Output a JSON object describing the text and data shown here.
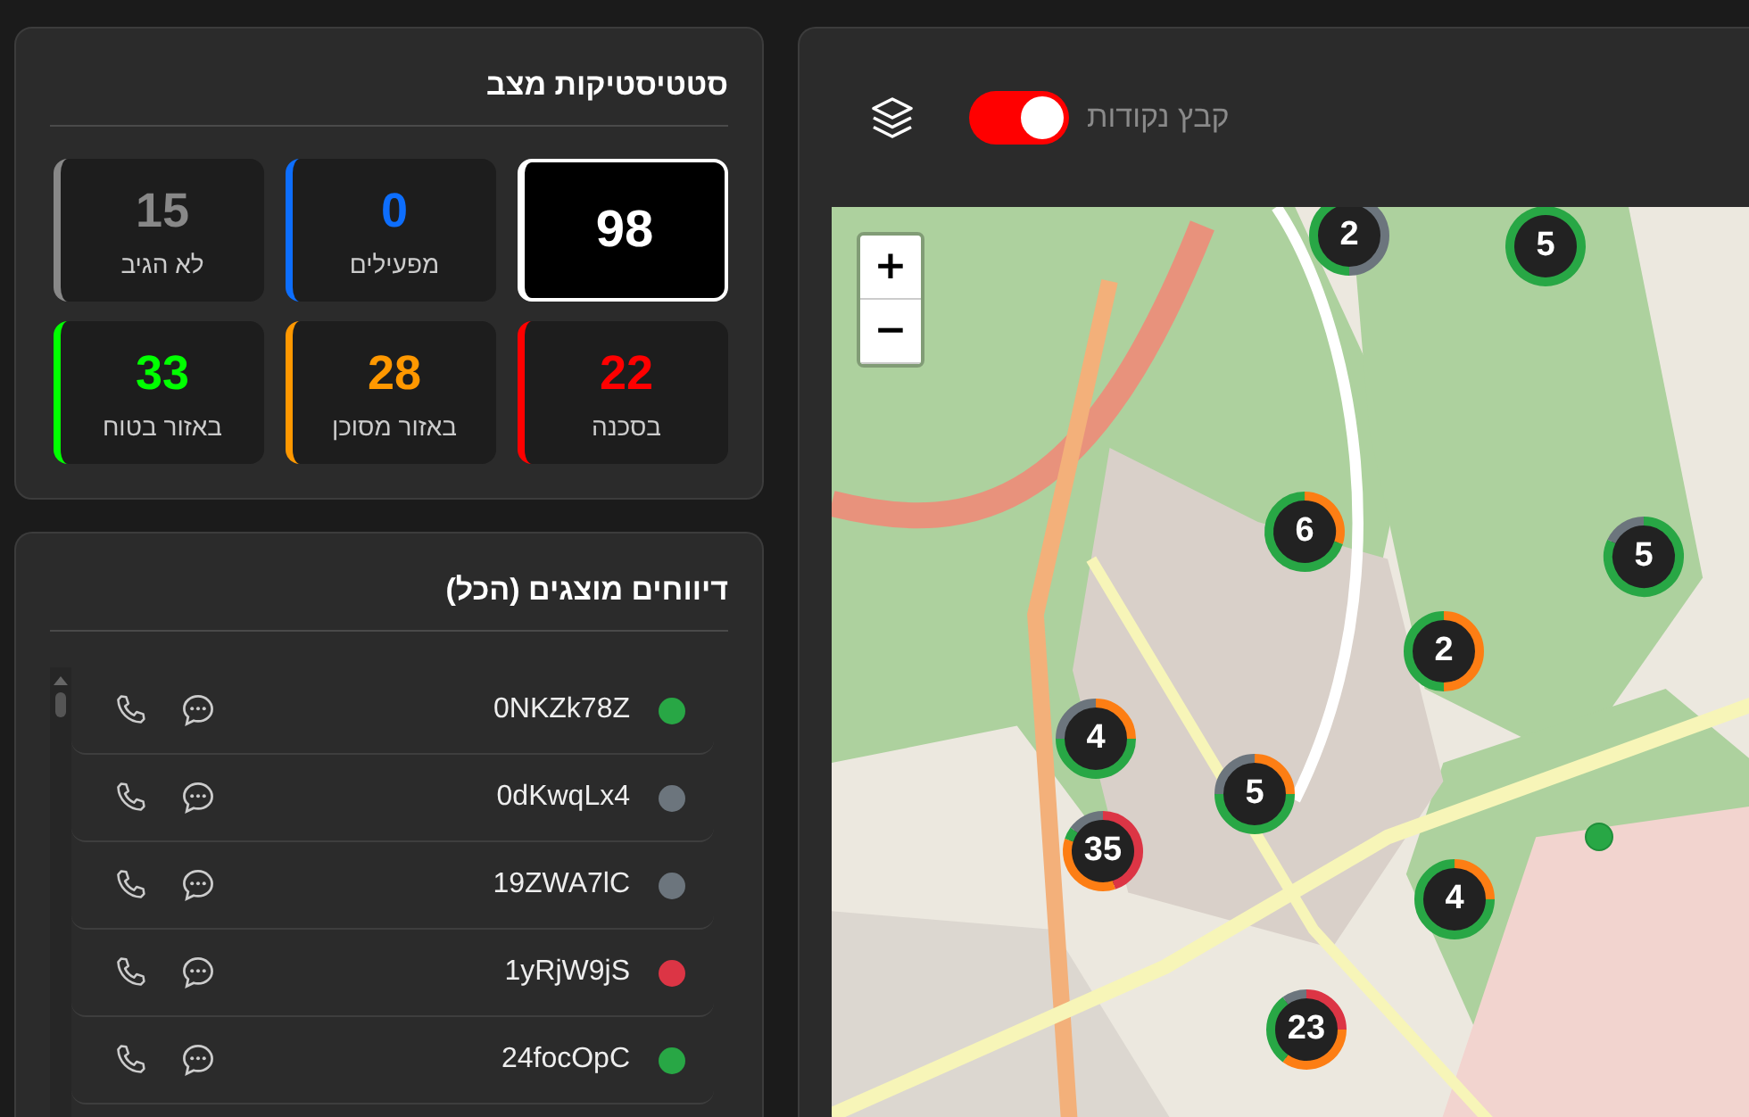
{
  "stats": {
    "title": "סטטיסטיקות מצב",
    "cards": [
      {
        "value": "98",
        "selected": true,
        "color": "#ffffff"
      },
      {
        "value": "0",
        "label": "מפעילים",
        "selected": false,
        "color": "#0d6efd"
      },
      {
        "value": "15",
        "label": "לא הגיב",
        "selected": false,
        "color": "#888888"
      },
      {
        "value": "22",
        "label": "בסכנה",
        "selected": false,
        "color": "#ff0000"
      },
      {
        "value": "28",
        "label": "באזור מסוכן",
        "selected": false,
        "color": "#ff9800"
      },
      {
        "value": "33",
        "label": "באזור בטוח",
        "selected": false,
        "color": "#00ff00"
      }
    ]
  },
  "reports": {
    "title": "דיווחים מוצגים (הכל)",
    "items": [
      {
        "id": "0NKZk78Z",
        "color": "#28a745"
      },
      {
        "id": "0dKwqLx4",
        "color": "#6c757d"
      },
      {
        "id": "19ZWA7lC",
        "color": "#6c757d"
      },
      {
        "id": "1yRjW9jS",
        "color": "#dc3545"
      },
      {
        "id": "24focOpC",
        "color": "#28a745"
      }
    ]
  },
  "map": {
    "cluster_toggle": {
      "label": "קבץ נקודות",
      "on": true
    },
    "zoom_in": "+",
    "zoom_out": "−",
    "clusters": [
      {
        "count": "2",
        "segments": [
          {
            "color": "#6c757d"
          },
          {
            "color": "#28a745"
          }
        ]
      },
      {
        "count": "5",
        "segments": [
          {
            "color": "#28a745"
          }
        ]
      },
      {
        "count": "6",
        "segments": [
          {
            "color": "#fd7e14"
          },
          {
            "color": "#28a745"
          }
        ]
      },
      {
        "count": "5",
        "segments": [
          {
            "color": "#28a745"
          },
          {
            "color": "#6c757d"
          }
        ]
      },
      {
        "count": "2",
        "segments": [
          {
            "color": "#fd7e14"
          },
          {
            "color": "#28a745"
          }
        ]
      },
      {
        "count": "4",
        "segments": [
          {
            "color": "#fd7e14"
          },
          {
            "color": "#28a745"
          },
          {
            "color": "#6c757d"
          }
        ]
      },
      {
        "count": "5",
        "segments": [
          {
            "color": "#fd7e14"
          },
          {
            "color": "#28a745"
          },
          {
            "color": "#6c757d"
          }
        ]
      },
      {
        "count": "35",
        "segments": [
          {
            "color": "#dc3545"
          },
          {
            "color": "#fd7e14"
          },
          {
            "color": "#28a745"
          },
          {
            "color": "#6c757d"
          }
        ]
      },
      {
        "count": "4",
        "segments": [
          {
            "color": "#fd7e14"
          },
          {
            "color": "#28a745"
          }
        ]
      },
      {
        "count": "23",
        "segments": [
          {
            "color": "#dc3545"
          },
          {
            "color": "#fd7e14"
          },
          {
            "color": "#28a745"
          },
          {
            "color": "#6c757d"
          }
        ]
      }
    ],
    "points": [
      {
        "color": "#28a745"
      }
    ]
  }
}
